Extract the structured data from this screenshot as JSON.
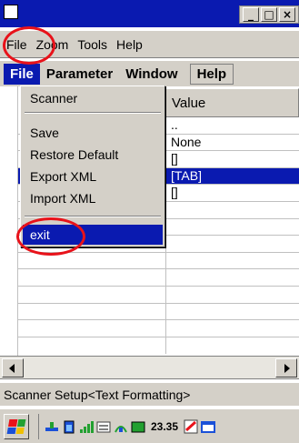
{
  "window": {
    "minimize_label": "_",
    "maximize_label": "□",
    "close_label": "×"
  },
  "outer_menu": [
    "File",
    "Zoom",
    "Tools",
    "Help"
  ],
  "app_menu": [
    "File",
    "Parameter",
    "Window",
    "Help"
  ],
  "file_menu": {
    "items": [
      "Scanner",
      "Save",
      "Restore Default",
      "Export XML",
      "Import XML",
      "exit"
    ],
    "highlighted": "exit"
  },
  "grid": {
    "column_header": "Value",
    "rows": [
      "..",
      "None",
      "[]",
      "[TAB]",
      "[]",
      "",
      "",
      "",
      "",
      "",
      "",
      "",
      ""
    ],
    "selected_row_index": 3
  },
  "status_text": "Scanner Setup<Text Formatting>",
  "taskbar": {
    "clock": "23.35"
  },
  "colors": {
    "selection": "#0a1ab0",
    "annotation": "#e8121a",
    "chrome": "#d4d0c8"
  },
  "icons": [
    "windows-flag-icon",
    "sync-icon",
    "battery-icon",
    "signal-icon",
    "keyboard-icon",
    "network-icon",
    "battery-level-icon",
    "tools-icon",
    "window-icon"
  ]
}
